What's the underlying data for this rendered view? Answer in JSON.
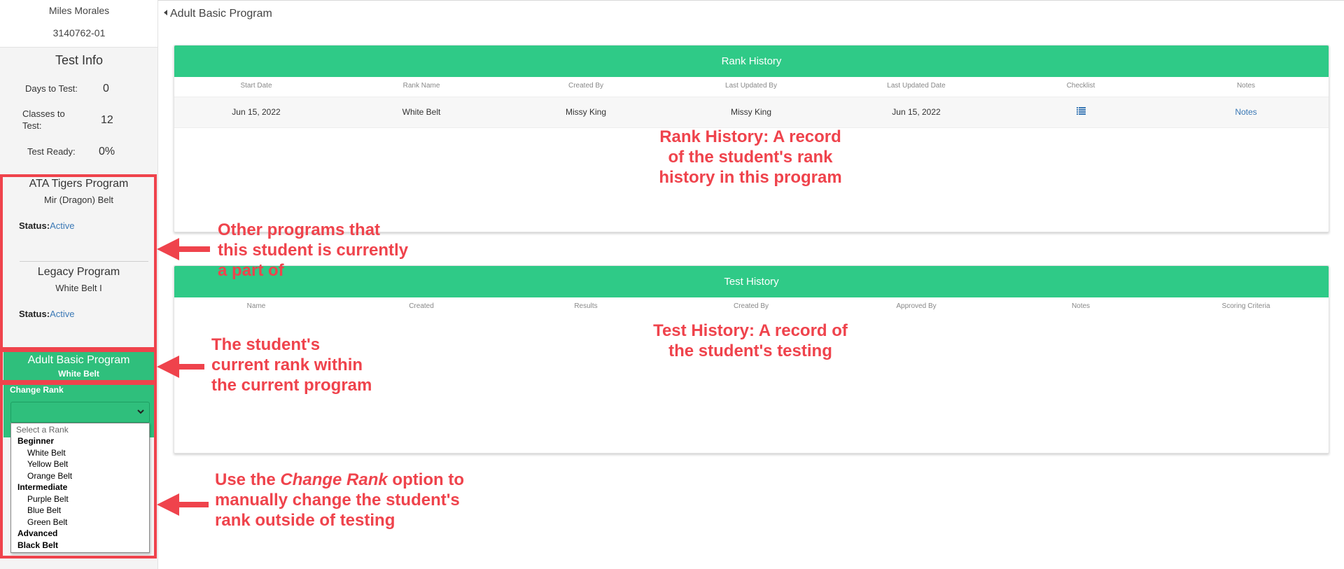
{
  "student": {
    "name": "Miles Morales",
    "id": "3140762-01"
  },
  "test_info": {
    "title": "Test Info",
    "days_label": "Days to Test:",
    "days_value": "0",
    "classes_label_1": "Classes to",
    "classes_label_2": "Test:",
    "classes_value": "12",
    "ready_label": "Test Ready:",
    "ready_value": "0%"
  },
  "other_programs": [
    {
      "name": "ATA Tigers Program",
      "rank": "Mir (Dragon) Belt",
      "status_label": "Status:",
      "status": "Active"
    },
    {
      "name": "Legacy Program",
      "rank": "White Belt I",
      "status_label": "Status:",
      "status": "Active"
    }
  ],
  "current_program": {
    "name": "Adult Basic Program",
    "rank": "White Belt"
  },
  "change_rank": {
    "label": "Change Rank",
    "placeholder": "Select a Rank",
    "groups": [
      {
        "label": "Beginner",
        "options": [
          "White Belt",
          "Yellow Belt",
          "Orange Belt"
        ]
      },
      {
        "label": "Intermediate",
        "options": [
          "Purple Belt",
          "Blue Belt",
          "Green Belt"
        ]
      },
      {
        "label": "Advanced",
        "options": []
      },
      {
        "label": "Black Belt",
        "options": []
      }
    ]
  },
  "back_link": "Adult Basic Program",
  "rank_history": {
    "title": "Rank History",
    "columns": [
      "Start Date",
      "Rank Name",
      "Created By",
      "Last Updated By",
      "Last Updated Date",
      "Checklist",
      "Notes"
    ],
    "rows": [
      {
        "start_date": "Jun 15, 2022",
        "rank_name": "White Belt",
        "created_by": "Missy King",
        "last_updated_by": "Missy King",
        "last_updated_date": "Jun 15, 2022",
        "checklist_icon": "list-icon",
        "notes": "Notes"
      }
    ]
  },
  "test_history": {
    "title": "Test History",
    "columns": [
      "Name",
      "Created",
      "Results",
      "Created By",
      "Approved By",
      "Notes",
      "Scoring Criteria"
    ]
  },
  "annotations": {
    "rank_history_1": "Rank History: A record",
    "rank_history_2": "of the student's rank",
    "rank_history_3": "history in this program",
    "other_programs_1": "Other programs that",
    "other_programs_2": "this student is currently",
    "other_programs_3": "a part of",
    "current_rank_1": "The student's",
    "current_rank_2": "current  rank within",
    "current_rank_3": "the current program",
    "test_history_1": "Test History: A record of",
    "test_history_2": "the student's testing",
    "change_rank_1a": "Use the ",
    "change_rank_1b": "Change Rank",
    "change_rank_1c": " option to",
    "change_rank_2": "manually change the student's",
    "change_rank_3": "rank outside of testing"
  },
  "colors": {
    "accent_green": "#2fca87",
    "sidebar_green": "#2fbf7c",
    "annotation_red": "#ef434c",
    "link_blue": "#3a78b5"
  }
}
